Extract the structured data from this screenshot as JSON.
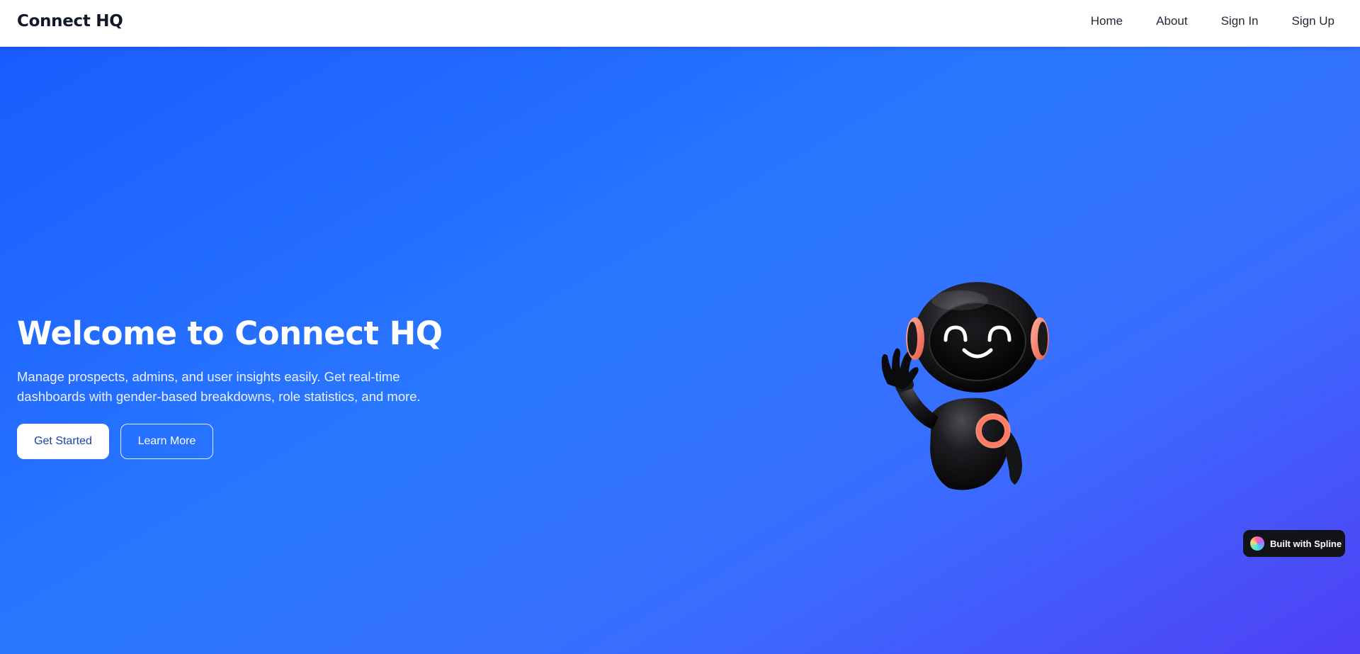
{
  "header": {
    "brand": "Connect HQ",
    "nav": [
      {
        "label": "Home"
      },
      {
        "label": "About"
      },
      {
        "label": "Sign In"
      },
      {
        "label": "Sign Up"
      }
    ]
  },
  "hero": {
    "title": "Welcome to Connect HQ",
    "subtitle": "Manage prospects, admins, and user insights easily. Get real-time dashboards with gender-based breakdowns, role statistics, and more.",
    "primary_button": "Get Started",
    "secondary_button": "Learn More",
    "illustration_icon": "waving-robot-icon"
  },
  "badge": {
    "label": "Built with Spline",
    "icon": "spline-logo-icon"
  },
  "colors": {
    "hero_gradient_start": "#1a5cff",
    "hero_gradient_end": "#5040f5",
    "primary_button_text": "#1e40af",
    "robot_accent": "#ff7b63",
    "badge_background": "#111318"
  }
}
